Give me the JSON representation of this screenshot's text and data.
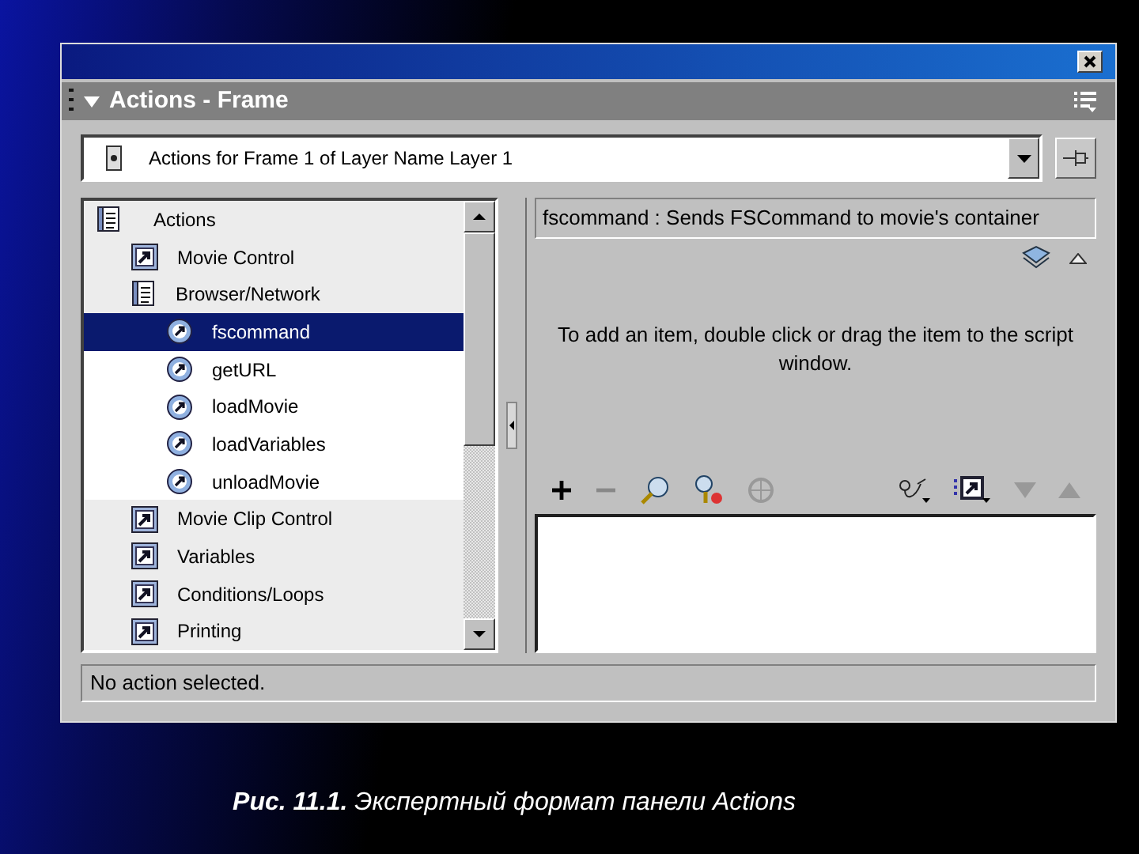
{
  "panel": {
    "title": "Actions - Frame"
  },
  "target": {
    "value": "Actions for Frame 1 of Layer Name Layer 1"
  },
  "toolbox": {
    "items": [
      {
        "label": "Actions",
        "kind": "category",
        "expanded": true,
        "selected": false,
        "children": [
          {
            "label": "Movie Control",
            "kind": "category",
            "expanded": false,
            "selected": false
          },
          {
            "label": "Browser/Network",
            "kind": "category",
            "expanded": true,
            "selected": false,
            "children": [
              {
                "label": "fscommand",
                "kind": "action",
                "selected": true
              },
              {
                "label": "getURL",
                "kind": "action",
                "selected": false
              },
              {
                "label": "loadMovie",
                "kind": "action",
                "selected": false
              },
              {
                "label": "loadVariables",
                "kind": "action",
                "selected": false
              },
              {
                "label": "unloadMovie",
                "kind": "action",
                "selected": false
              }
            ]
          },
          {
            "label": "Movie Clip Control",
            "kind": "category",
            "expanded": false,
            "selected": false
          },
          {
            "label": "Variables",
            "kind": "category",
            "expanded": false,
            "selected": false
          },
          {
            "label": "Conditions/Loops",
            "kind": "category",
            "expanded": false,
            "selected": false
          },
          {
            "label": "Printing",
            "kind": "category",
            "expanded": false,
            "selected": false
          }
        ]
      }
    ]
  },
  "description": "fscommand : Sends FSCommand to movie's container",
  "hint": "To add an item, double click or drag the item to the script window.",
  "status_bar": "No action selected.",
  "caption": "**Рис. 11.1.** Экспертный формат панели Actions"
}
